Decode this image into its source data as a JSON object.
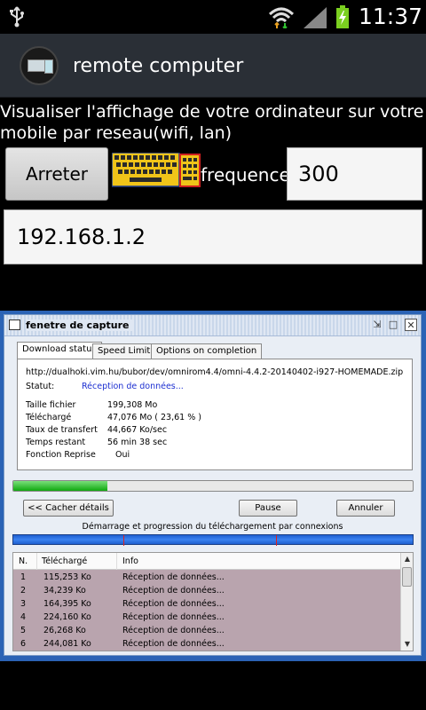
{
  "statusbar": {
    "time": "11:37"
  },
  "app": {
    "title": "remote computer"
  },
  "description": "Visualiser l'affichage de votre ordinateur sur votre mobile par reseau(wifi, lan)",
  "controls": {
    "stop_label": "Arreter",
    "frequency_label": "frequence",
    "frequency_value": "300",
    "ip_value": "192.168.1.2"
  },
  "capture": {
    "window_title": "fenetre de capture",
    "tabs": [
      {
        "label": "Download status"
      },
      {
        "label": "Speed Limiter"
      },
      {
        "label": "Options on completion"
      }
    ],
    "url": "http://dualhoki.vim.hu/bubor/dev/omnirom4.4/omni-4.4.2-20140402-i927-HOMEMADE.zip",
    "status_label": "Statut:",
    "status_value": "Réception de données...",
    "info": [
      {
        "key": "Taille fichier",
        "value": "199,308  Mo"
      },
      {
        "key": "Téléchargé",
        "value": "47,076  Mo  ( 23,61 % )"
      },
      {
        "key": "Taux de transfert",
        "value": "44,667  Ko/sec"
      },
      {
        "key": "Temps restant",
        "value": "56 min 38 sec"
      },
      {
        "key": "Fonction Reprise",
        "value": "   Oui"
      }
    ],
    "progress_fraction": 0.2361,
    "buttons": {
      "hide_details": "<< Cacher détails",
      "pause": "Pause",
      "cancel": "Annuler"
    },
    "connections_label": "Démarrage et progression du téléchargement par connexions",
    "list": {
      "headers": {
        "n": "N.",
        "downloaded": "Téléchargé",
        "info": "Info"
      },
      "rows": [
        {
          "n": "1",
          "downloaded": "115,253  Ko",
          "info": "Réception de données..."
        },
        {
          "n": "2",
          "downloaded": "34,239  Ko",
          "info": "Réception de données..."
        },
        {
          "n": "3",
          "downloaded": "164,395  Ko",
          "info": "Réception de données..."
        },
        {
          "n": "4",
          "downloaded": "224,160  Ko",
          "info": "Réception de données..."
        },
        {
          "n": "5",
          "downloaded": "26,268  Ko",
          "info": "Réception de données..."
        },
        {
          "n": "6",
          "downloaded": "244,081  Ko",
          "info": "Réception de données..."
        }
      ]
    }
  },
  "colors": {
    "actionbar": "#2a2f36",
    "capture_frame": "#2b63b5",
    "progress_green": "#0fa80f",
    "status_blue": "#1c2fd1",
    "list_bg": "#b9a4ae"
  }
}
